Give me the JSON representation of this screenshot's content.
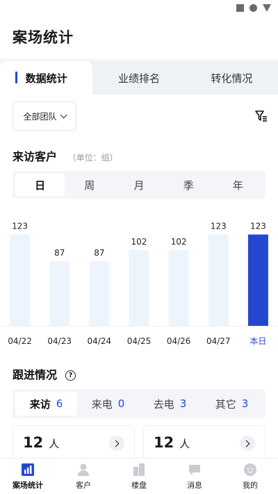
{
  "app": {
    "title": "案场统计"
  },
  "tabs": [
    {
      "label": "数据统计",
      "active": true
    },
    {
      "label": "业绩排名",
      "active": false
    },
    {
      "label": "转化情况",
      "active": false
    }
  ],
  "filter": {
    "team_label": "全部团队"
  },
  "visitors": {
    "title": "来访客户",
    "unit": "（单位：组）",
    "periods": [
      "日",
      "周",
      "月",
      "季",
      "年"
    ],
    "active_period": "日"
  },
  "chart_data": {
    "type": "bar",
    "categories": [
      "04/22",
      "04/23",
      "04/24",
      "04/25",
      "04/26",
      "04/27",
      "本日"
    ],
    "values": [
      123,
      87,
      87,
      102,
      102,
      123,
      123
    ],
    "highlight_index": 6,
    "ylim": [
      0,
      145
    ],
    "colors": {
      "bar": "#eef4fd",
      "highlight": "#2547d0",
      "highlight_label": "#2547d0"
    }
  },
  "follow": {
    "title": "跟进情况",
    "tabs": [
      {
        "label": "来访",
        "count": "6",
        "active": true
      },
      {
        "label": "来电",
        "count": "0",
        "active": false
      },
      {
        "label": "去电",
        "count": "3",
        "active": false
      },
      {
        "label": "其它",
        "count": "3",
        "active": false
      }
    ],
    "cards": [
      {
        "value": "12",
        "unit": "人"
      },
      {
        "value": "12",
        "unit": "人"
      }
    ]
  },
  "bottom_nav": [
    {
      "label": "案场统计",
      "icon": "stats-chart-icon",
      "active": true
    },
    {
      "label": "客户",
      "icon": "customer-icon",
      "active": false
    },
    {
      "label": "楼盘",
      "icon": "building-icon",
      "active": false
    },
    {
      "label": "消息",
      "icon": "message-icon",
      "active": false
    },
    {
      "label": "我的",
      "icon": "profile-icon",
      "active": false
    }
  ]
}
